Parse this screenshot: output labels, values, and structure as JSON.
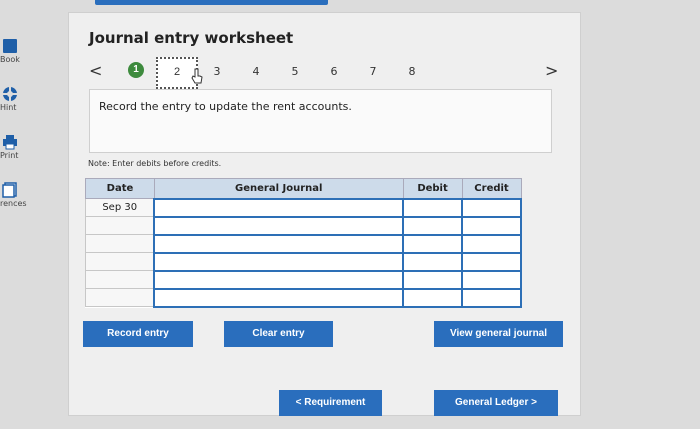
{
  "sidebar": {
    "items": [
      {
        "label": "Book",
        "icon": "book-icon"
      },
      {
        "label": "Hint",
        "icon": "lifebuoy-icon"
      },
      {
        "label": "Print",
        "icon": "printer-icon"
      },
      {
        "label": "rences",
        "icon": "references-icon"
      }
    ]
  },
  "worksheet": {
    "title": "Journal entry worksheet",
    "nav_prev": "<",
    "nav_next": ">",
    "steps": [
      "1",
      "2",
      "3",
      "4",
      "5",
      "6",
      "7",
      "8"
    ],
    "current_step": "2",
    "instruction": "Record the entry to update the rent accounts.",
    "note": "Note: Enter debits before credits."
  },
  "journal": {
    "headers": {
      "date": "Date",
      "account": "General Journal",
      "debit": "Debit",
      "credit": "Credit"
    },
    "rows": [
      {
        "date": "Sep 30",
        "account": "",
        "debit": "",
        "credit": ""
      },
      {
        "date": "",
        "account": "",
        "debit": "",
        "credit": ""
      },
      {
        "date": "",
        "account": "",
        "debit": "",
        "credit": ""
      },
      {
        "date": "",
        "account": "",
        "debit": "",
        "credit": ""
      },
      {
        "date": "",
        "account": "",
        "debit": "",
        "credit": ""
      },
      {
        "date": "",
        "account": "",
        "debit": "",
        "credit": ""
      }
    ]
  },
  "buttons": {
    "record": "Record entry",
    "clear": "Clear entry",
    "view": "View general journal",
    "requirement": "<  Requirement",
    "ledger": "General Ledger  >"
  },
  "colors": {
    "accent": "#2a6ebd",
    "step_done": "#3e8b3e",
    "header_bg": "#cddbea"
  }
}
